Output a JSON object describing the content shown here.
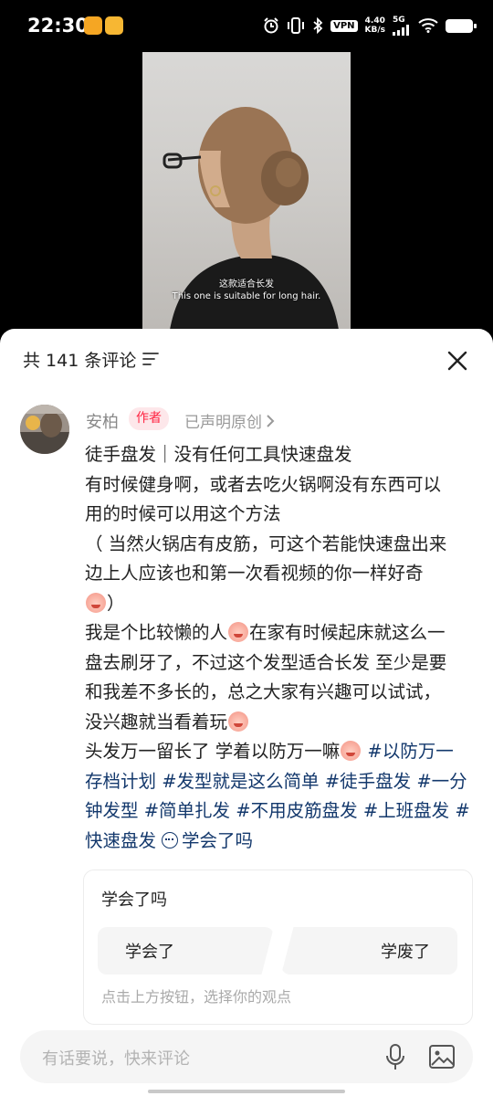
{
  "status_bar": {
    "time": "22:30",
    "vpn": "VPN",
    "speed_value": "4.40",
    "speed_unit": "KB/s",
    "network": "5G"
  },
  "video": {
    "subtitle_cn": "这款适合长发",
    "subtitle_en": "This one is suitable for long hair."
  },
  "comments_header": {
    "count_label": "共 141 条评论"
  },
  "author": {
    "name": "安柏",
    "badge": "作者",
    "original_note": "已声明原创"
  },
  "post": {
    "line1": "徒手盘发｜没有任何工具快速盘发",
    "line2": "有时候健身啊，或者去吃火锅啊没有东西可以",
    "line3": "用的时候可以用这个方法",
    "line4": "（ 当然火锅店有皮筋，可这个若能快速盘出来",
    "line5": "边上人应该也和第一次看视频的你一样好奇",
    "line6_tail": "）",
    "line7a": "我是个比较懒的人",
    "line7b": "在家有时候起床就这么一",
    "line8": "盘去刷牙了，不过这个发型适合长发 至少是要",
    "line9": "和我差不多长的，总之大家有兴趣可以试试，",
    "line10": "没兴趣就当看着玩",
    "line11a": "头发万一留长了 学着以防万一嘛",
    "tag1": "#以防万一",
    "tag2": "存档计划",
    "tag3": "#发型就是这么简单",
    "tag4": "#徒手盘发",
    "tag5": "#一分",
    "tag6": "钟发型",
    "tag7": "#简单扎发",
    "tag8": "#不用皮筋盘发",
    "tag9": "#上班盘发",
    "tag10": "#",
    "tag11": "快速盘发",
    "poll_link": "学会了吗"
  },
  "poll": {
    "title": "学会了吗",
    "option_left": "学会了",
    "option_right": "学废了",
    "hint": "点击上方按钮，选择你的观点"
  },
  "input": {
    "placeholder": "有话要说，快来评论"
  },
  "icons": {
    "sort": "sort-icon",
    "close": "close-icon",
    "mic": "mic-icon",
    "image": "image-icon",
    "chevron": "chevron-right-icon",
    "emoji": "crying-face-emoji"
  },
  "colors": {
    "author_badge_text": "#ff2442",
    "author_badge_bg": "#fde7ea",
    "hashtag": "#13386c"
  }
}
